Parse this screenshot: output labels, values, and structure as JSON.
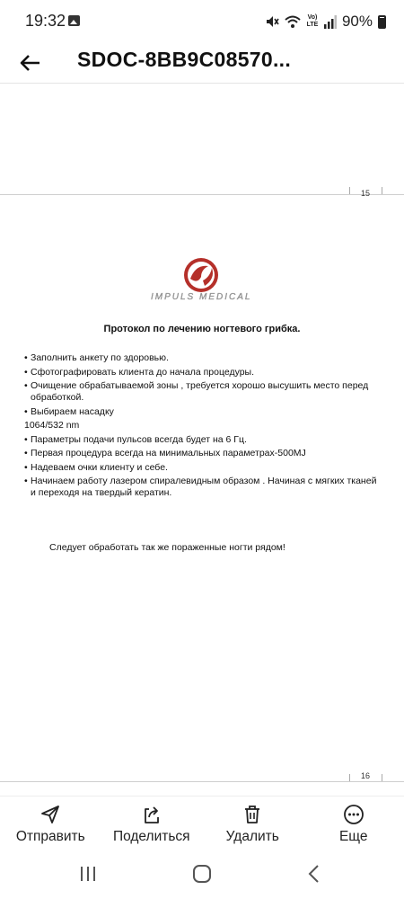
{
  "status_bar": {
    "time": "19:32",
    "battery": "90%"
  },
  "app_bar": {
    "title": "SDOC-8BB9C08570..."
  },
  "document": {
    "page_top_number": "15",
    "page_bottom_number": "16",
    "logo_text": "IMPULS MEDICAL",
    "heading": "Протокол по лечению ногтевого грибка.",
    "lines": [
      "Заполнить анкету по здоровью.",
      "Сфотографировать клиента до начала процедуры.",
      "Очищение обрабатываемой зоны , требуется хорошо высушить место перед обработкой.",
      "Выбираем насадку",
      "1064/532 nm",
      "Параметры подачи пульсов всегда будет на 6 Гц.",
      "Первая процедура всегда на минимальных параметрах-500MJ",
      "Надеваем очки клиенту и себе.",
      "Начинаем работу лазером спиралевидным образом . Начиная с мягких тканей и переходя на твердый кератин."
    ],
    "footer": "Следует обработать так же пораженные ногти рядом!"
  },
  "actions": {
    "send": "Отправить",
    "share": "Поделиться",
    "delete": "Удалить",
    "more": "Еще"
  },
  "colors": {
    "logo_red": "#b5302a",
    "text": "#111111"
  }
}
